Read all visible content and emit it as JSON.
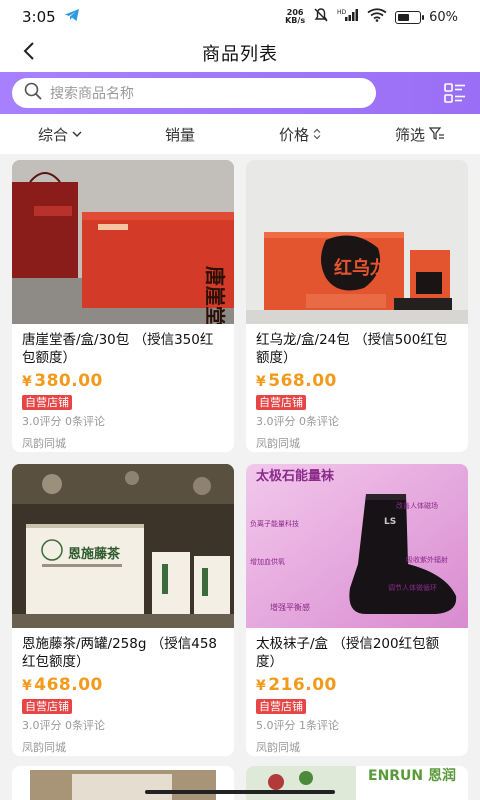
{
  "status": {
    "time": "3:05",
    "net_top": "206",
    "net_bottom": "KB/s",
    "battery": "60%",
    "battery_level": 0.6
  },
  "nav": {
    "title": "商品列表"
  },
  "search": {
    "placeholder": "搜索商品名称"
  },
  "sort": {
    "tabs": [
      "综合",
      "销量",
      "价格",
      "筛选"
    ]
  },
  "products": [
    {
      "name": "唐崖堂香/盒/30包 （授信350红包额度）",
      "price": "380.00",
      "badge": "自营店铺",
      "meta": "3.0评分 0条评论",
      "shop": "凤韵同城"
    },
    {
      "name": "红乌龙/盒/24包 （授信500红包额度）",
      "price": "568.00",
      "badge": "自营店铺",
      "meta": "3.0评分 0条评论",
      "shop": "凤韵同城"
    },
    {
      "name": "恩施藤茶/两罐/258g （授信458红包额度）",
      "price": "468.00",
      "badge": "自营店铺",
      "meta": "3.0评分 0条评论",
      "shop": "凤韵同城"
    },
    {
      "name": "太极袜子/盒 （授信200红包额度）",
      "price": "216.00",
      "badge": "自营店铺",
      "meta": "5.0评分 1条评论",
      "shop": "凤韵同城"
    }
  ],
  "image_text": {
    "p1_box": "唐崖堂香",
    "p2_box": "红乌龙",
    "p3_box": "恩施藤茶",
    "p4_top": "太极石能量袜",
    "p4_sock": "LS",
    "p4_tags": [
      "改善人体磁场",
      "负离子能量科技",
      "吸收紫外辐射",
      "增加血供氧",
      "调节人体微循环",
      "增强平衡感"
    ],
    "partial2_text": "ENRUN 恩润"
  },
  "yen": "¥"
}
